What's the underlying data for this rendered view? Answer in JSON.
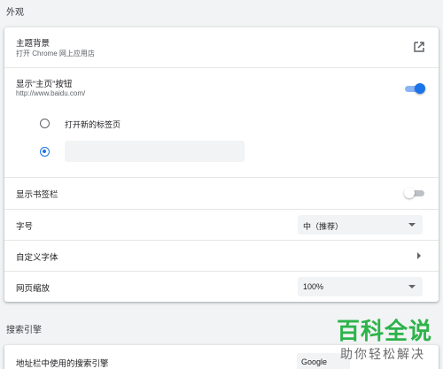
{
  "appearance": {
    "section_title": "外观",
    "theme": {
      "label": "主题背景",
      "sublabel": "打开 Chrome 网上应用店",
      "icon": "external-link-icon"
    },
    "home_button": {
      "label": "显示“主页”按钮",
      "sublabel": "http://www.baidu.com/",
      "enabled": true,
      "options": [
        {
          "label": "打开新的标签页",
          "checked": false
        },
        {
          "label": "",
          "checked": true
        }
      ],
      "custom_url_value": ""
    },
    "bookmarks_bar": {
      "label": "显示书签栏",
      "enabled": false
    },
    "font_size": {
      "label": "字号",
      "value": "中（推荐）"
    },
    "custom_fonts": {
      "label": "自定义字体"
    },
    "page_zoom": {
      "label": "网页缩放",
      "value": "100%"
    }
  },
  "search": {
    "section_title": "搜索引擎",
    "engine_row": {
      "label": "地址栏中使用的搜索引擎",
      "value": "Google"
    }
  },
  "watermark": {
    "line1": "百科全说",
    "line2": "助你轻松解决"
  },
  "colors": {
    "accent": "#1a73e8",
    "watermark_green": "#2db34a"
  }
}
